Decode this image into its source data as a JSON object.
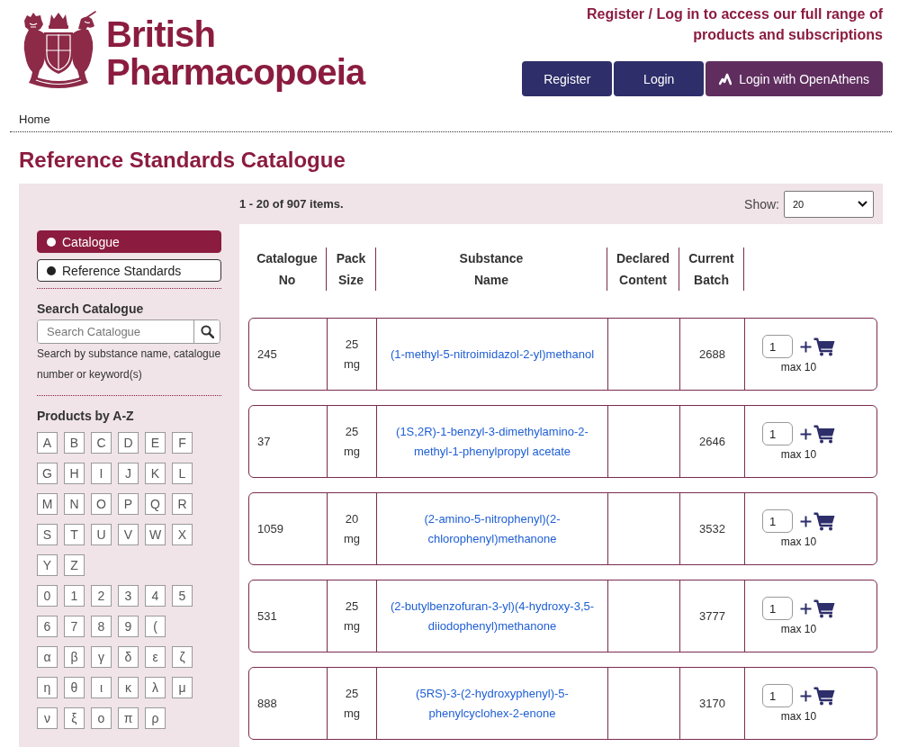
{
  "header": {
    "logo_text": "British Pharmacopoeia",
    "access_message": "Register / Log in to access our full range of products and subscriptions",
    "buttons": [
      {
        "label": "Register",
        "kind": "standard"
      },
      {
        "label": "Login",
        "kind": "standard"
      },
      {
        "label": "Login with OpenAthens",
        "kind": "openathens"
      }
    ]
  },
  "breadcrumb": [
    {
      "label": "Home"
    }
  ],
  "page_title": "Reference Standards Catalogue",
  "sidebar": {
    "view_toggle": [
      {
        "label": "Catalogue",
        "selected": true
      },
      {
        "label": "Reference Standards",
        "selected": false
      }
    ],
    "search": {
      "heading": "Search Catalogue",
      "placeholder": "Search Catalogue",
      "help_text": "Search by substance name, catalogue number or keyword(s)"
    },
    "a_to_z": {
      "heading": "Products by A-Z",
      "groups": [
        [
          "A",
          "B",
          "C",
          "D",
          "E",
          "F",
          "G",
          "H",
          "I",
          "J",
          "K",
          "L",
          "M",
          "N",
          "O",
          "P",
          "Q",
          "R",
          "S",
          "T",
          "U",
          "V",
          "W",
          "X",
          "Y",
          "Z"
        ],
        [
          "0",
          "1",
          "2",
          "3",
          "4",
          "5",
          "6",
          "7",
          "8",
          "9",
          "("
        ],
        [
          "α",
          "β",
          "γ",
          "δ",
          "ε",
          "ζ",
          "η",
          "θ",
          "ι",
          "κ",
          "λ",
          "μ",
          "ν",
          "ξ",
          "ο",
          "π",
          "ρ"
        ]
      ]
    }
  },
  "results_bar": {
    "summary": "1 - 20 of 907 items.",
    "show_label": "Show:",
    "show_value": "20"
  },
  "table": {
    "columns": [
      "Catalogue No",
      "Pack Size",
      "Substance Name",
      "Declared Content",
      "Current Batch"
    ],
    "rows": [
      {
        "catalogue_no": "245",
        "pack_size": "25 mg",
        "substance_name": "(1-methyl-5-nitroimidazol-2-yl)methanol",
        "current_batch": "2688",
        "quantity": "1",
        "limit": "max 10"
      },
      {
        "catalogue_no": "37",
        "pack_size": "25 mg",
        "substance_name": "(1S,2R)-1-benzyl-3-dimethylamino-2-methyl-1-phenylpropyl acetate",
        "current_batch": "2646",
        "quantity": "1",
        "limit": "max 10"
      },
      {
        "catalogue_no": "1059",
        "pack_size": "20 mg",
        "substance_name": "(2-amino-5-nitrophenyl)(2-chlorophenyl)methanone",
        "current_batch": "3532",
        "quantity": "1",
        "limit": "max 10"
      },
      {
        "catalogue_no": "531",
        "pack_size": "25 mg",
        "substance_name": "(2-butylbenzofuran-3-yl)(4-hydroxy-3,5-diiodophenyl)methanone",
        "current_batch": "3777",
        "quantity": "1",
        "limit": "max 10"
      },
      {
        "catalogue_no": "888",
        "pack_size": "25 mg",
        "substance_name": "(5RS)-3-(2-hydroxyphenyl)-5-phenylcyclohex-2-enone",
        "current_batch": "3170",
        "quantity": "1",
        "limit": "max 10"
      }
    ]
  }
}
